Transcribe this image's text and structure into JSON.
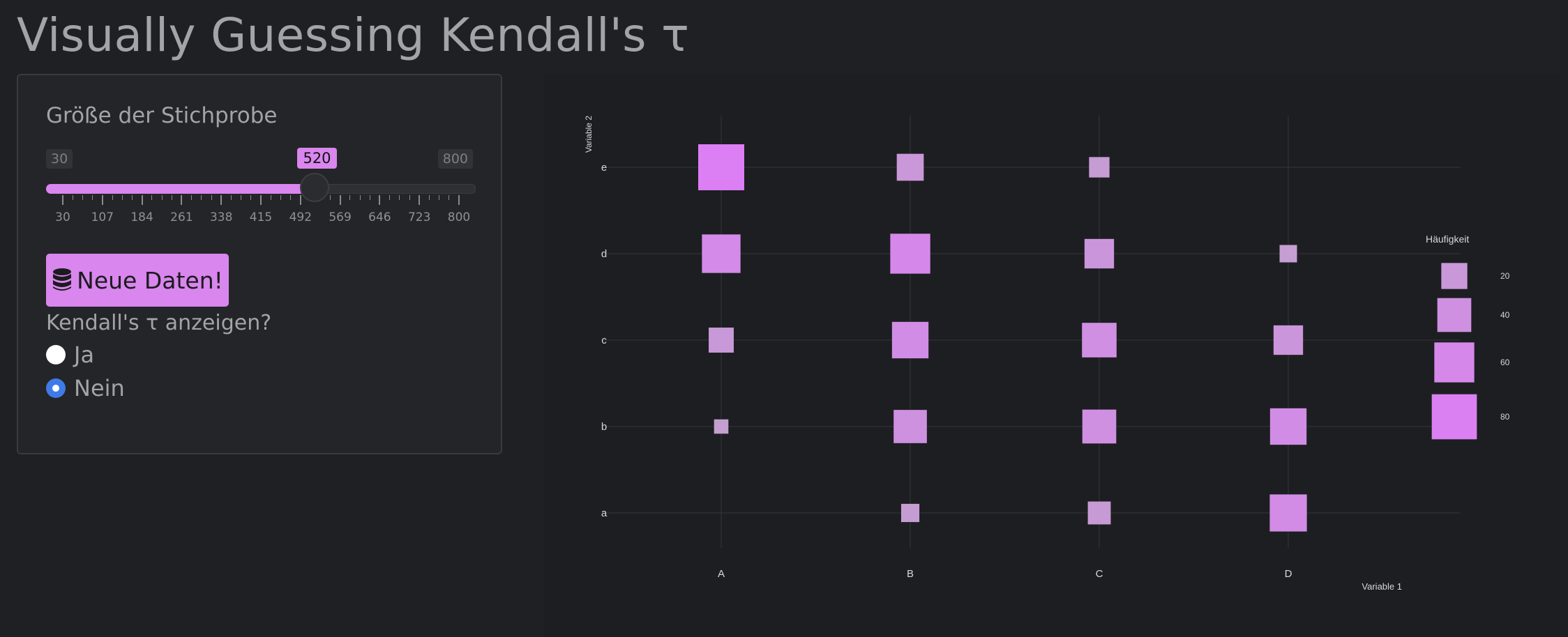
{
  "title": "Visually Guessing Kendall's τ",
  "slider": {
    "label": "Größe der Stichprobe",
    "min": 30,
    "max": 800,
    "value": 520,
    "min_label": "30",
    "max_label": "800",
    "value_label": "520",
    "tick_labels": [
      "30",
      "107",
      "184",
      "261",
      "338",
      "415",
      "492",
      "569",
      "646",
      "723",
      "800"
    ]
  },
  "button": {
    "label": "Neue Daten!",
    "icon": "database-icon"
  },
  "radio": {
    "question": "Kendall's τ anzeigen?",
    "options": [
      {
        "label": "Ja",
        "checked": false
      },
      {
        "label": "Nein",
        "checked": true
      }
    ]
  },
  "colors": {
    "accent": "#d986ee",
    "radio_checked": "#3f7be8",
    "low": "#c3a0d0",
    "high": "#dc7ef4"
  },
  "chart_data": {
    "type": "scatter",
    "title": "",
    "xlabel": "Variable 1",
    "ylabel": "Variable 2",
    "x_categories": [
      "A",
      "B",
      "C",
      "D"
    ],
    "y_categories": [
      "a",
      "b",
      "c",
      "d",
      "e"
    ],
    "points": [
      {
        "x": "A",
        "y": "e",
        "value": 84
      },
      {
        "x": "B",
        "y": "e",
        "value": 22
      },
      {
        "x": "C",
        "y": "e",
        "value": 10
      },
      {
        "x": "D",
        "y": "e",
        "value": 0
      },
      {
        "x": "A",
        "y": "d",
        "value": 55
      },
      {
        "x": "B",
        "y": "d",
        "value": 60
      },
      {
        "x": "C",
        "y": "d",
        "value": 28
      },
      {
        "x": "D",
        "y": "d",
        "value": 6
      },
      {
        "x": "A",
        "y": "c",
        "value": 18
      },
      {
        "x": "B",
        "y": "c",
        "value": 48
      },
      {
        "x": "C",
        "y": "c",
        "value": 42
      },
      {
        "x": "D",
        "y": "c",
        "value": 28
      },
      {
        "x": "A",
        "y": "b",
        "value": 3
      },
      {
        "x": "B",
        "y": "b",
        "value": 38
      },
      {
        "x": "C",
        "y": "b",
        "value": 40
      },
      {
        "x": "D",
        "y": "b",
        "value": 48
      },
      {
        "x": "A",
        "y": "a",
        "value": 0
      },
      {
        "x": "B",
        "y": "a",
        "value": 7
      },
      {
        "x": "C",
        "y": "a",
        "value": 14
      },
      {
        "x": "D",
        "y": "a",
        "value": 50
      }
    ],
    "legend": {
      "title": "Häufigkeit",
      "placement": "right",
      "entries": [
        {
          "label": "20",
          "value": 20
        },
        {
          "label": "40",
          "value": 40
        },
        {
          "label": "60",
          "value": 60
        },
        {
          "label": "80",
          "value": 80
        }
      ]
    },
    "grid": true
  }
}
